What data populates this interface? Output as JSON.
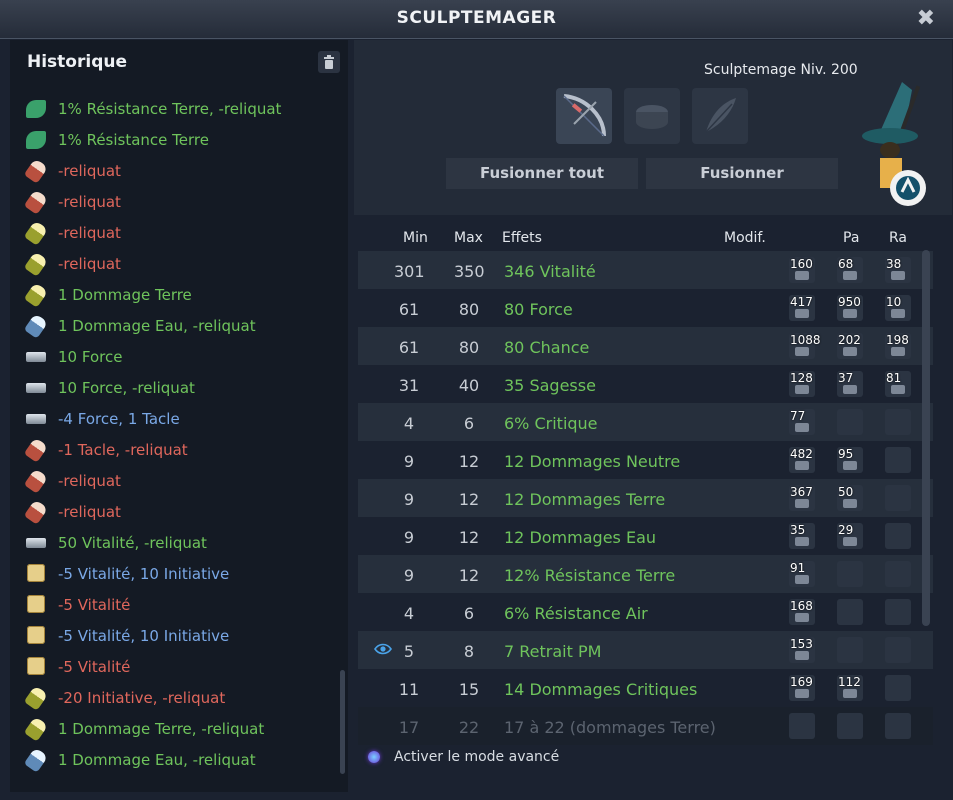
{
  "window": {
    "title": "SCULPTEMAGER",
    "close_label": "✖"
  },
  "history": {
    "title": "Historique",
    "items": [
      {
        "text": "1% Résistance Terre, -reliquat",
        "color": "green",
        "icon": "leaf"
      },
      {
        "text": "1% Résistance Terre",
        "color": "green",
        "icon": "leaf"
      },
      {
        "text": "-reliquat",
        "color": "red",
        "icon": "rune-red"
      },
      {
        "text": "-reliquat",
        "color": "red",
        "icon": "rune-red"
      },
      {
        "text": "-reliquat",
        "color": "red",
        "icon": "rune-yellow"
      },
      {
        "text": "-reliquat",
        "color": "red",
        "icon": "rune-yellow"
      },
      {
        "text": "1 Dommage Terre",
        "color": "green",
        "icon": "rune-yellow"
      },
      {
        "text": "1 Dommage Eau, -reliquat",
        "color": "green",
        "icon": "rune-blue"
      },
      {
        "text": "10 Force",
        "color": "green",
        "icon": "bar"
      },
      {
        "text": "10 Force, -reliquat",
        "color": "green",
        "icon": "bar"
      },
      {
        "text": "-4 Force, 1 Tacle",
        "color": "blue",
        "icon": "bar"
      },
      {
        "text": "-1 Tacle, -reliquat",
        "color": "red",
        "icon": "rune-red"
      },
      {
        "text": "-reliquat",
        "color": "red",
        "icon": "rune-red"
      },
      {
        "text": "-reliquat",
        "color": "red",
        "icon": "rune-red"
      },
      {
        "text": "50 Vitalité, -reliquat",
        "color": "green",
        "icon": "bar"
      },
      {
        "text": "-5 Vitalité, 10 Initiative",
        "color": "blue",
        "icon": "die"
      },
      {
        "text": "-5 Vitalité",
        "color": "red",
        "icon": "die"
      },
      {
        "text": "-5 Vitalité, 10 Initiative",
        "color": "blue",
        "icon": "die"
      },
      {
        "text": "-5 Vitalité",
        "color": "red",
        "icon": "die"
      },
      {
        "text": "-20 Initiative, -reliquat",
        "color": "red",
        "icon": "rune-yellow"
      },
      {
        "text": "1 Dommage Terre, -reliquat",
        "color": "green",
        "icon": "rune-yellow"
      },
      {
        "text": "1 Dommage Eau, -reliquat",
        "color": "green",
        "icon": "rune-blue"
      }
    ]
  },
  "top": {
    "level": "Sculptemage Niv. 200",
    "fuse_all": "Fusionner tout",
    "fuse": "Fusionner"
  },
  "table": {
    "headers": {
      "min": "Min",
      "max": "Max",
      "effects": "Effets",
      "modif": "Modif.",
      "pa": "Pa",
      "ra": "Ra"
    },
    "rows": [
      {
        "min": "301",
        "max": "350",
        "effect": "346 Vitalité",
        "modif": "160",
        "pa": "68",
        "ra": "38"
      },
      {
        "min": "61",
        "max": "80",
        "effect": "80 Force",
        "modif": "417",
        "pa": "950",
        "ra": "10"
      },
      {
        "min": "61",
        "max": "80",
        "effect": "80 Chance",
        "modif": "1088",
        "pa": "202",
        "ra": "198"
      },
      {
        "min": "31",
        "max": "40",
        "effect": "35 Sagesse",
        "modif": "128",
        "pa": "37",
        "ra": "81"
      },
      {
        "min": "4",
        "max": "6",
        "effect": "6% Critique",
        "modif": "77",
        "pa": "",
        "ra": ""
      },
      {
        "min": "9",
        "max": "12",
        "effect": "12 Dommages Neutre",
        "modif": "482",
        "pa": "95",
        "ra": ""
      },
      {
        "min": "9",
        "max": "12",
        "effect": "12 Dommages Terre",
        "modif": "367",
        "pa": "50",
        "ra": ""
      },
      {
        "min": "9",
        "max": "12",
        "effect": "12 Dommages Eau",
        "modif": "35",
        "pa": "29",
        "ra": ""
      },
      {
        "min": "9",
        "max": "12",
        "effect": "12% Résistance Terre",
        "modif": "91",
        "pa": "",
        "ra": ""
      },
      {
        "min": "4",
        "max": "6",
        "effect": "6% Résistance Air",
        "modif": "168",
        "pa": "",
        "ra": ""
      },
      {
        "min": "5",
        "max": "8",
        "effect": "7 Retrait PM",
        "modif": "153",
        "pa": "",
        "ra": "",
        "eye": true
      },
      {
        "min": "11",
        "max": "15",
        "effect": "14 Dommages Critiques",
        "modif": "169",
        "pa": "112",
        "ra": ""
      },
      {
        "min": "17",
        "max": "22",
        "effect": "17 à 22 (dommages Terre)",
        "modif": "",
        "pa": "",
        "ra": "",
        "muted": true
      }
    ]
  },
  "advanced_mode_label": "Activer le mode avancé",
  "colors": {
    "green": "#6fc45c",
    "red": "#e0675c",
    "blue": "#7aa8e6",
    "background": "#1b2230"
  }
}
